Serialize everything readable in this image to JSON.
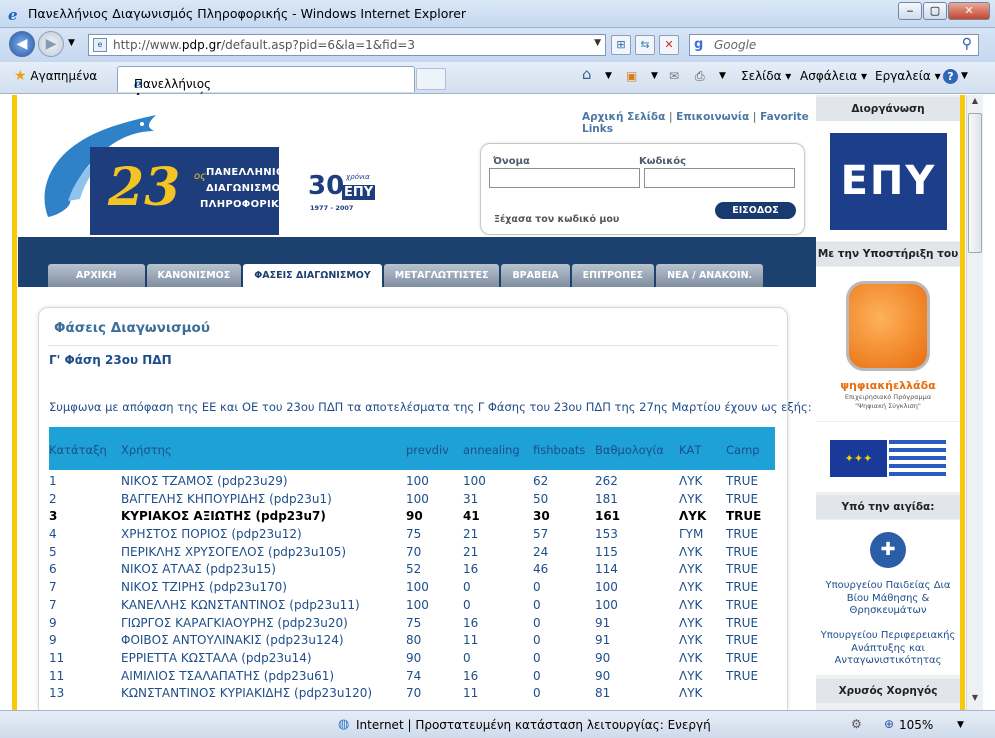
{
  "window": {
    "title": "Πανελλήνιος Διαγωνισμός Πληροφορικής - Windows Internet Explorer"
  },
  "address": {
    "prefix": "http://www.",
    "domain": "pdp.gr",
    "path": "/default.asp?pid=6&la=1&fid=3"
  },
  "search": {
    "provider": "g",
    "placeholder": "Google"
  },
  "favorites": {
    "label": "Αγαπημένα"
  },
  "tab": {
    "title": "Πανελλήνιος Διαγωνισμός Πληροφορικής"
  },
  "commandbar": {
    "page": "Σελίδα",
    "safety": "Ασφάλεια",
    "tools": "Εργαλεία"
  },
  "site": {
    "logo": {
      "number": "23",
      "suffix": "ος",
      "line1": "ΠΑΝΕΛΛΗΝΙΟΣ",
      "line2": "ΔΙΑΓΩΝΙΣΜΟΣ",
      "line3": "ΠΛΗΡΟΦΟΡΙΚΗΣ"
    },
    "anniv": {
      "num": "30",
      "word": "χρόνια",
      "org": "ΕΠΥ",
      "years": "1977 - 2007"
    },
    "toplinks": [
      "Αρχική Σελίδα",
      "Επικοινωνία",
      "Favorite Links"
    ],
    "login": {
      "name_label": "Όνομα",
      "code_label": "Κωδικός",
      "forgot": "Ξέχασα τον κωδικό μου",
      "submit": "ΕΙΣΟΔΟΣ"
    },
    "nav": [
      "ΑΡΧΙΚΗ",
      "ΚΑΝΟΝΙΣΜΟΣ",
      "ΦΑΣΕΙΣ ΔΙΑΓΩΝΙΣΜΟΥ",
      "ΜΕΤΑΓΛΩΤΤΙΣΤΕΣ",
      "ΒΡΑΒΕΙΑ",
      "ΕΠΙΤΡΟΠΕΣ",
      "ΝΕΑ / ΑΝΑΚΟΙΝ."
    ]
  },
  "content": {
    "title": "Φάσεις Διαγωνισμού",
    "subtitle": "Γ' Φάση 23ου ΠΔΠ",
    "para": "Συμφωνα με απόφαση της ΕΕ και ΟΕ του 23ου ΠΔΠ τα αποτελέσματα της Γ Φάσης του 23ου ΠΔΠ  της 27ης Μαρτίου έχουν ως εξής:",
    "headers": [
      "Κατάταξη",
      "Χρήστης",
      "prevdiv",
      "annealing",
      "fishboats",
      "Βαθμολογία",
      "ΚΑΤ",
      "Camp"
    ],
    "rows": [
      [
        "1",
        "ΝΙΚΟΣ ΤΖΑΜΟΣ (pdp23u29)",
        "100",
        "100",
        "62",
        "262",
        "ΛΥΚ",
        "TRUE"
      ],
      [
        "2",
        "ΒΑΓΓΕΛΗΣ ΚΗΠΟΥΡΙΔΗΣ (pdp23u1)",
        "100",
        "31",
        "50",
        "181",
        "ΛΥΚ",
        "TRUE"
      ],
      [
        "3",
        "ΚΥΡΙΑΚΟΣ ΑΞΙΩΤΗΣ (pdp23u7)",
        "90",
        "41",
        "30",
        "161",
        "ΛΥΚ",
        "TRUE"
      ],
      [
        "4",
        "ΧΡΗΣΤΟΣ ΠΟΡΙΟΣ (pdp23u12)",
        "75",
        "21",
        "57",
        "153",
        "ΓΥΜ",
        "TRUE"
      ],
      [
        "5",
        "ΠΕΡΙΚΛΗΣ ΧΡΥΣΟΓΕΛΟΣ (pdp23u105)",
        "70",
        "21",
        "24",
        "115",
        "ΛΥΚ",
        "TRUE"
      ],
      [
        "6",
        "ΝΙΚΟΣ ΑΤΛΑΣ (pdp23u15)",
        "52",
        "16",
        "46",
        "114",
        "ΛΥΚ",
        "TRUE"
      ],
      [
        "7",
        "ΝΙΚΟΣ ΤΖΙΡΗΣ (pdp23u170)",
        "100",
        "0",
        "0",
        "100",
        "ΛΥΚ",
        "TRUE"
      ],
      [
        "7",
        "ΚΑΝΕΛΛΗΣ ΚΩΝΣΤΑΝΤΙΝΟΣ (pdp23u11)",
        "100",
        "0",
        "0",
        "100",
        "ΛΥΚ",
        "TRUE"
      ],
      [
        "9",
        "ΓΙΩΡΓΟΣ ΚΑΡΑΓΚΙΑΟΥΡΗΣ (pdp23u20)",
        "75",
        "16",
        "0",
        "91",
        "ΛΥΚ",
        "TRUE"
      ],
      [
        "9",
        "ΦΟΙΒΟΣ ΑΝΤΟΥΛΙΝΑΚΙΣ (pdp23u124)",
        "80",
        "11",
        "0",
        "91",
        "ΛΥΚ",
        "TRUE"
      ],
      [
        "11",
        "ΕΡΡΙΕΤΤΑ ΚΩΣΤΑΛΑ (pdp23u14)",
        "90",
        "0",
        "0",
        "90",
        "ΛΥΚ",
        "TRUE"
      ],
      [
        "11",
        "ΑΙΜΙΛΙΟΣ ΤΣΑΛΑΠΑΤΗΣ (pdp23u61)",
        "74",
        "16",
        "0",
        "90",
        "ΛΥΚ",
        "TRUE"
      ],
      [
        "13",
        "ΚΩΝΣΤΑΝΤΙΝΟΣ ΚΥΡΙΑΚΙΔΗΣ (pdp23u120)",
        "70",
        "11",
        "0",
        "81",
        "ΛΥΚ",
        ""
      ]
    ]
  },
  "sidebar": {
    "org_title": "Διοργάνωση",
    "org_logo": "ΕΠΥ",
    "support_title": "Με την Υποστήριξη του",
    "digital_name": "ψηφιακήελλάδα",
    "digital_sub1": "Επιχειρησιακό Πρόγραμμα",
    "digital_sub2": "\"Ψηφιακή Σύγκλιση\"",
    "aegis_title": "Υπό την αιγίδα:",
    "ministry1": "Υπουργείου Παιδείας Δια Βίου Μάθησης & Θρησκευμάτων",
    "ministry2": "Υπουργείου Περιφερειακής Ανάπτυξης και Ανταγωνιστικότητας",
    "sponsor_title": "Χρυσός Χορηγός"
  },
  "status": {
    "text": "Internet | Προστατευμένη κατάσταση λειτουργίας: Ενεργή",
    "zoom": "105%"
  },
  "colors": {
    "accent": "#f6c90b",
    "nav": "#1d416f",
    "table_header": "#1ea1d6",
    "text": "#1d4e8a"
  }
}
